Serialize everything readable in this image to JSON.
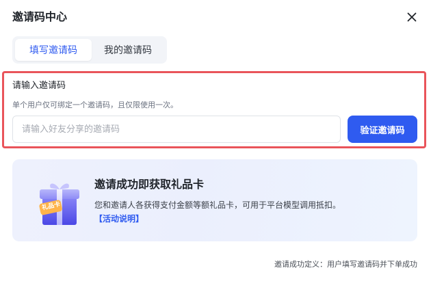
{
  "dialog": {
    "title": "邀请码中心",
    "close_icon": "close-icon"
  },
  "tabs": [
    {
      "label": "填写邀请码",
      "active": true
    },
    {
      "label": "我的邀请码",
      "active": false
    }
  ],
  "form": {
    "label": "请输入邀请码",
    "hint": "单个用户仅可绑定一个邀请码，且仅限使用一次。",
    "placeholder": "请输入好友分享的邀请码",
    "value": "",
    "submit_label": "验证邀请码"
  },
  "promo": {
    "title": "邀请成功即获取礼品卡",
    "description": "您和邀请人各获得支付金额等额礼品卡，可用于平台模型调用抵扣。",
    "link": "【活动说明】",
    "gift_tag": "礼品卡",
    "icon": "gift-icon"
  },
  "footer": {
    "note": "邀请成功定义：用户填写邀请码并下单成功"
  },
  "colors": {
    "primary": "#2f5bf0",
    "highlight": "#e9545a",
    "card_background": "#eef1fd"
  }
}
